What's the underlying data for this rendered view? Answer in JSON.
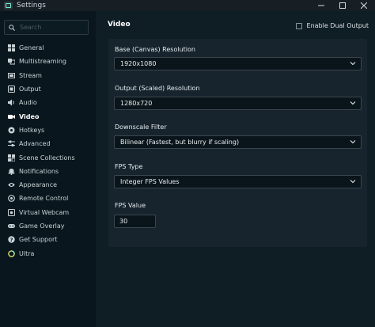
{
  "window": {
    "title": "Settings",
    "buttons": [
      "minimize",
      "maximize",
      "close"
    ]
  },
  "sidebar": {
    "search_placeholder": "Search",
    "items": [
      {
        "label": "General",
        "icon": "grid-icon"
      },
      {
        "label": "Multistreaming",
        "icon": "multistream-icon"
      },
      {
        "label": "Stream",
        "icon": "stream-icon"
      },
      {
        "label": "Output",
        "icon": "output-icon"
      },
      {
        "label": "Audio",
        "icon": "speaker-icon"
      },
      {
        "label": "Video",
        "icon": "camera-icon",
        "active": true
      },
      {
        "label": "Hotkeys",
        "icon": "keyboard-icon"
      },
      {
        "label": "Advanced",
        "icon": "sliders-icon"
      },
      {
        "label": "Scene Collections",
        "icon": "collections-icon"
      },
      {
        "label": "Notifications",
        "icon": "bell-icon"
      },
      {
        "label": "Appearance",
        "icon": "eye-icon"
      },
      {
        "label": "Remote Control",
        "icon": "remote-icon"
      },
      {
        "label": "Virtual Webcam",
        "icon": "webcam-icon"
      },
      {
        "label": "Game Overlay",
        "icon": "overlay-icon"
      },
      {
        "label": "Get Support",
        "icon": "help-icon"
      },
      {
        "label": "Ultra",
        "icon": "ultra-icon"
      }
    ]
  },
  "main": {
    "title": "Video",
    "dual_output_label": "Enable Dual Output",
    "dual_output_checked": false,
    "fields": {
      "base_resolution": {
        "label": "Base (Canvas) Resolution",
        "value": "1920x1080"
      },
      "output_resolution": {
        "label": "Output (Scaled) Resolution",
        "value": "1280x720"
      },
      "downscale_filter": {
        "label": "Downscale Filter",
        "value": "Bilinear (Fastest, but blurry if scaling)"
      },
      "fps_type": {
        "label": "FPS Type",
        "value": "Integer FPS Values"
      },
      "fps_value": {
        "label": "FPS Value",
        "value": "30"
      }
    }
  },
  "colors": {
    "background": "#09161d",
    "panel": "#0f1d25",
    "card": "#17242d",
    "input_bg": "#0a151b",
    "accent": "#7ee8c9"
  }
}
